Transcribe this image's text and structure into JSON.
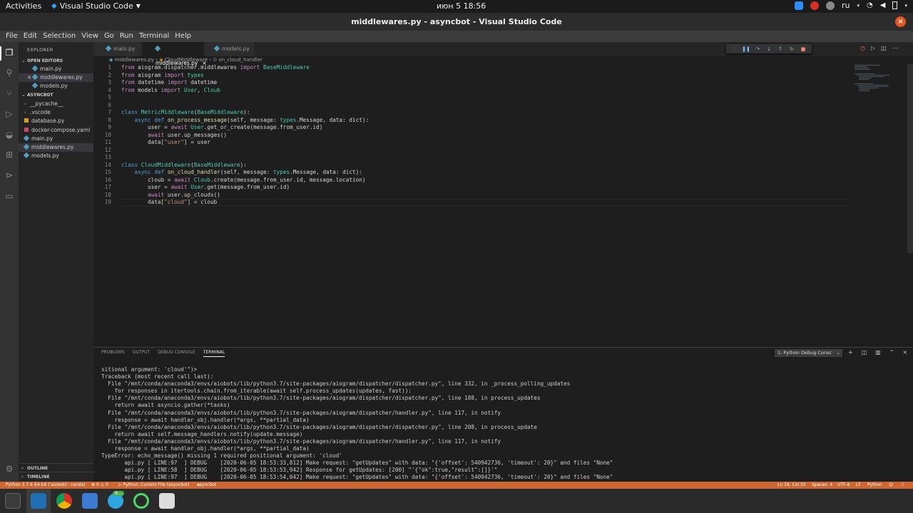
{
  "gnome": {
    "activities": "Activities",
    "app_name": "Visual Studio Code",
    "clock": "июн 5  18:56",
    "lang": "ru"
  },
  "window": {
    "title": "middlewares.py - asyncbot - Visual Studio Code"
  },
  "menu": [
    "File",
    "Edit",
    "Selection",
    "View",
    "Go",
    "Run",
    "Terminal",
    "Help"
  ],
  "sidebar": {
    "title": "EXPLORER",
    "open_editors_label": "OPEN EDITORS",
    "open_editors": [
      "main.py",
      "middlewares.py",
      "models.py"
    ],
    "project_label": "ASYNCBOT",
    "files": [
      "__pycache__",
      ".vscode",
      "database.py",
      "docker-compose.yaml",
      "main.py",
      "middlewares.py",
      "models.py"
    ],
    "outline_label": "OUTLINE",
    "timeline_label": "TIMELINE"
  },
  "tabs": [
    "main.py",
    "middlewares.py",
    "models.py"
  ],
  "breadcrumb": [
    "middlewares.py",
    "CloudMiddleware",
    "on_cloud_handler"
  ],
  "code_lines": [
    "from aiogram.dispatcher.middlewares import BaseMiddleware",
    "from aiogram import types",
    "from datetime import datetime",
    "from models import User, Cloub",
    "",
    "",
    "class MetricMiddleware(BaseMiddleware):",
    "    async def on_process_message(self, message: types.Message, data: dict):",
    "        user = await User.get_or_create(message.from_user.id)",
    "        await user.up_messages()",
    "        data[\"user\"] = user",
    "",
    "",
    "class CloudMiddleware(BaseMiddleware):",
    "    async def on_cloud_handler(self, message: types.Message, data: dict):",
    "        cloub = await Cloub.create(message.from_user.id, message.location)",
    "        user = await User.get(message.from_user.id)",
    "        await user.up_clouds()",
    "        data[\"cloud\"] = cloub"
  ],
  "panel": {
    "tabs": [
      "PROBLEMS",
      "OUTPUT",
      "DEBUG CONSOLE",
      "TERMINAL"
    ],
    "terminal_select": "1: Python Debug Consc",
    "terminal_lines": [
      "sitional argument: 'cloud'\")>",
      "Traceback (most recent call last):",
      "  File \"/mnt/conda/anaconda3/envs/aiobots/lib/python3.7/site-packages/aiogram/dispatcher/dispatcher.py\", line 332, in _process_polling_updates",
      "    for responses in itertools.chain.from_iterable(await self.process_updates(updates, fast)):",
      "  File \"/mnt/conda/anaconda3/envs/aiobots/lib/python3.7/site-packages/aiogram/dispatcher/dispatcher.py\", line 188, in process_updates",
      "    return await asyncio.gather(*tasks)",
      "  File \"/mnt/conda/anaconda3/envs/aiobots/lib/python3.7/site-packages/aiogram/dispatcher/handler.py\", line 117, in notify",
      "    response = await handler_obj.handler(*args, **partial_data)",
      "  File \"/mnt/conda/anaconda3/envs/aiobots/lib/python3.7/site-packages/aiogram/dispatcher/dispatcher.py\", line 208, in process_update",
      "    return await self.message_handlers.notify(update.message)",
      "  File \"/mnt/conda/anaconda3/envs/aiobots/lib/python3.7/site-packages/aiogram/dispatcher/handler.py\", line 117, in notify",
      "    response = await handler_obj.handler(*args, **partial_data)",
      "TypeError: echo_message() missing 1 required positional argument: 'cloud'",
      "       api.py [ LINE:97  ] DEBUG    [2020-06-05 18:53:33,812] Make request: \"getUpdates\" with data: \"{'offset': 540942736, 'timeout': 20}\" and files \"None\"",
      "       api.py [ LINE:58  ] DEBUG    [2020-06-05 18:53:53,942] Response for getUpdates: [200] \"'{\"ok\":true,\"result\":[]}'\"",
      "       api.py [ LINE:97  ] DEBUG    [2020-06-05 18:53:54,042] Make request: \"getUpdates\" with data: \"{'offset': 540942736, 'timeout': 20}\" and files \"None\""
    ]
  },
  "status": {
    "interpreter": "Python 3.7.6 64-bit ('aiobots': conda)",
    "problems": "⊗ 0 ⚠ 0",
    "debug_config": "▷ Python: Current File (asyncbot)",
    "folder": "asyncbot",
    "position": "Ln 19, Col 30",
    "spaces": "Spaces: 4",
    "encoding": "UTF-8",
    "eol": "LF",
    "language": "Python"
  },
  "dock_badge": "9..."
}
